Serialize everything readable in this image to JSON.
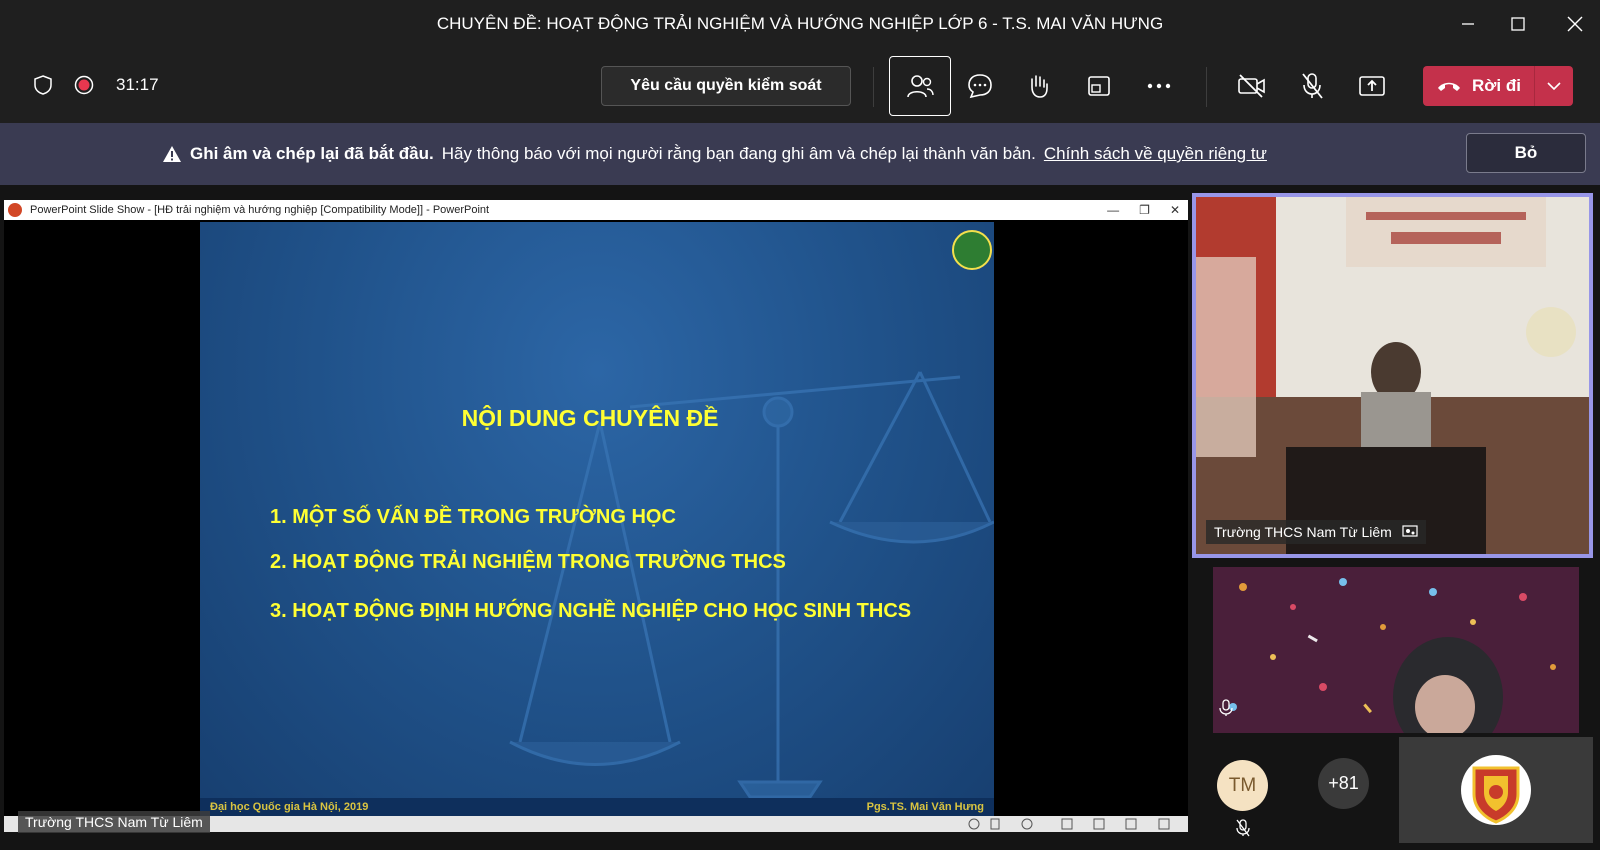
{
  "window": {
    "title": "CHUYÊN ĐỀ: HOẠT ĐỘNG TRẢI NGHIỆM VÀ HƯỚNG NGHIỆP LỚP 6 - T.S. MAI VĂN HƯNG"
  },
  "toolbar": {
    "timer": "31:17",
    "request_control_label": "Yêu cầu quyền kiểm soát",
    "leave_label": "Rời đi"
  },
  "banner": {
    "bold_text": "Ghi âm và chép lại đã bắt đầu.",
    "text": "Hãy thông báo với mọi người rằng bạn đang ghi âm và chép lại thành văn bản.",
    "link_text": "Chính sách về quyền riêng tư",
    "dismiss_label": "Bỏ"
  },
  "shared_screen": {
    "window_title": "PowerPoint Slide Show - [HĐ trải nghiệm và hướng nghiệp [Compatibility Mode]] - PowerPoint",
    "presenter_label": "Trường THCS Nam Từ Liêm",
    "slide": {
      "heading": "NỘI DUNG CHUYÊN ĐỀ",
      "items": [
        "1. MỘT SỐ VẤN ĐỀ TRONG TRƯỜNG HỌC",
        "2. HOẠT ĐỘNG TRẢI NGHIỆM TRONG TRƯỜNG THCS",
        "3. HOẠT ĐỘNG ĐỊNH HƯỚNG NGHỀ NGHIỆP CHO HỌC SINH THCS"
      ],
      "footer_left": "Đại học Quốc gia Hà Nội, 2019",
      "footer_right": "Pgs.TS. Mai Văn Hưng"
    }
  },
  "participants": {
    "tile1_name": "Trường THCS Nam Từ Liêm",
    "avatar_initials": "TM",
    "overflow_count": "+81"
  },
  "colors": {
    "leave_red": "#c4314b",
    "banner_bg": "#3a3b52",
    "active_border": "#9896e8",
    "slide_text": "#ffff33"
  }
}
